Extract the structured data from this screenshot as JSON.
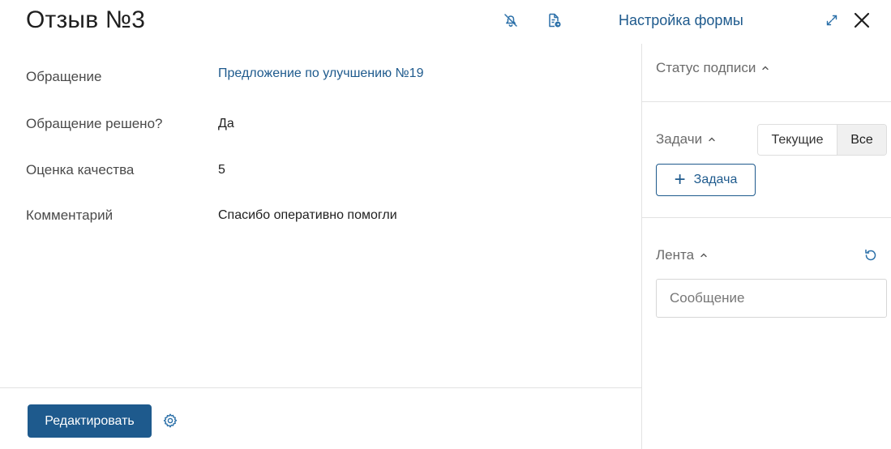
{
  "header": {
    "title": "Отзыв №3",
    "form_settings": "Настройка формы"
  },
  "fields": [
    {
      "label": "Обращение",
      "value": "Предложение по улучшению №19"
    },
    {
      "label": "Обращение решено?",
      "value": "Да"
    },
    {
      "label": "Оценка качества",
      "value": "5"
    },
    {
      "label": "Комментарий",
      "value": "Спасибо оперативно помогли"
    }
  ],
  "footer": {
    "edit_label": "Редактировать"
  },
  "sidebar": {
    "signature_status": "Статус подписи",
    "tasks": {
      "title": "Задачи",
      "toggle_current": "Текущие",
      "toggle_all": "Все",
      "add_task": "Задача"
    },
    "feed": {
      "title": "Лента",
      "message_placeholder": "Сообщение"
    }
  },
  "colors": {
    "accent": "#1e5a8d",
    "icon_blue": "#2a6fa8"
  },
  "icons": [
    "bell-off-icon",
    "document-export-icon",
    "expand-icon",
    "close-icon",
    "gear-icon",
    "chevron-up-icon",
    "plus-icon",
    "refresh-icon"
  ]
}
